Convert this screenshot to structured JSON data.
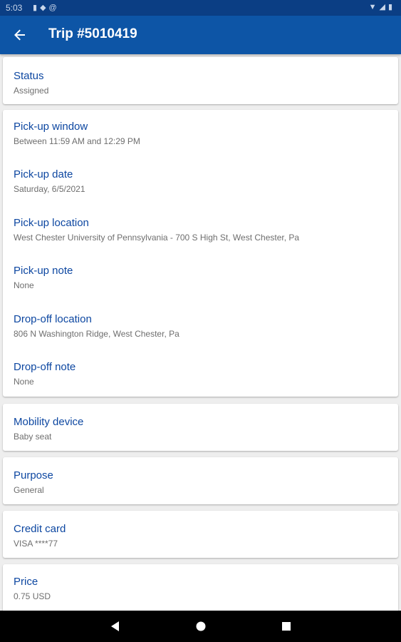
{
  "status_bar": {
    "time": "5:03",
    "left_icons": [
      "sd-card-icon",
      "shield-icon",
      "at-icon"
    ],
    "right_icons": [
      "wifi-icon",
      "signal-icon",
      "battery-icon"
    ]
  },
  "app_bar": {
    "title": "Trip #5010419",
    "back_icon": "arrow-left-icon"
  },
  "status": {
    "label": "Status",
    "value": "Assigned"
  },
  "pickup": {
    "window": {
      "label": "Pick-up window",
      "value": "Between 11:59 AM and 12:29 PM"
    },
    "date": {
      "label": "Pick-up date",
      "value": "Saturday, 6/5/2021"
    },
    "location": {
      "label": "Pick-up location",
      "value": "West Chester University of Pennsylvania - 700 S High St, West Chester, Pa"
    },
    "note": {
      "label": "Pick-up note",
      "value": "None"
    }
  },
  "dropoff": {
    "location": {
      "label": "Drop-off location",
      "value": "806 N Washington Ridge, West Chester, Pa"
    },
    "note": {
      "label": "Drop-off note",
      "value": "None"
    }
  },
  "mobility": {
    "label": "Mobility device",
    "value": "Baby seat"
  },
  "purpose": {
    "label": "Purpose",
    "value": "General"
  },
  "credit_card": {
    "label": "Credit card",
    "value": "VISA ****77"
  },
  "price": {
    "label": "Price",
    "value": "0.75 USD"
  },
  "colors": {
    "app_bar": "#0d55a6",
    "status_bar": "#0b3e84",
    "label_text": "#0d47a1",
    "value_text": "#6e6e6e",
    "background": "#eeeeee"
  },
  "nav_bar": {
    "icons": [
      "back-triangle-icon",
      "home-circle-icon",
      "recents-square-icon"
    ]
  }
}
